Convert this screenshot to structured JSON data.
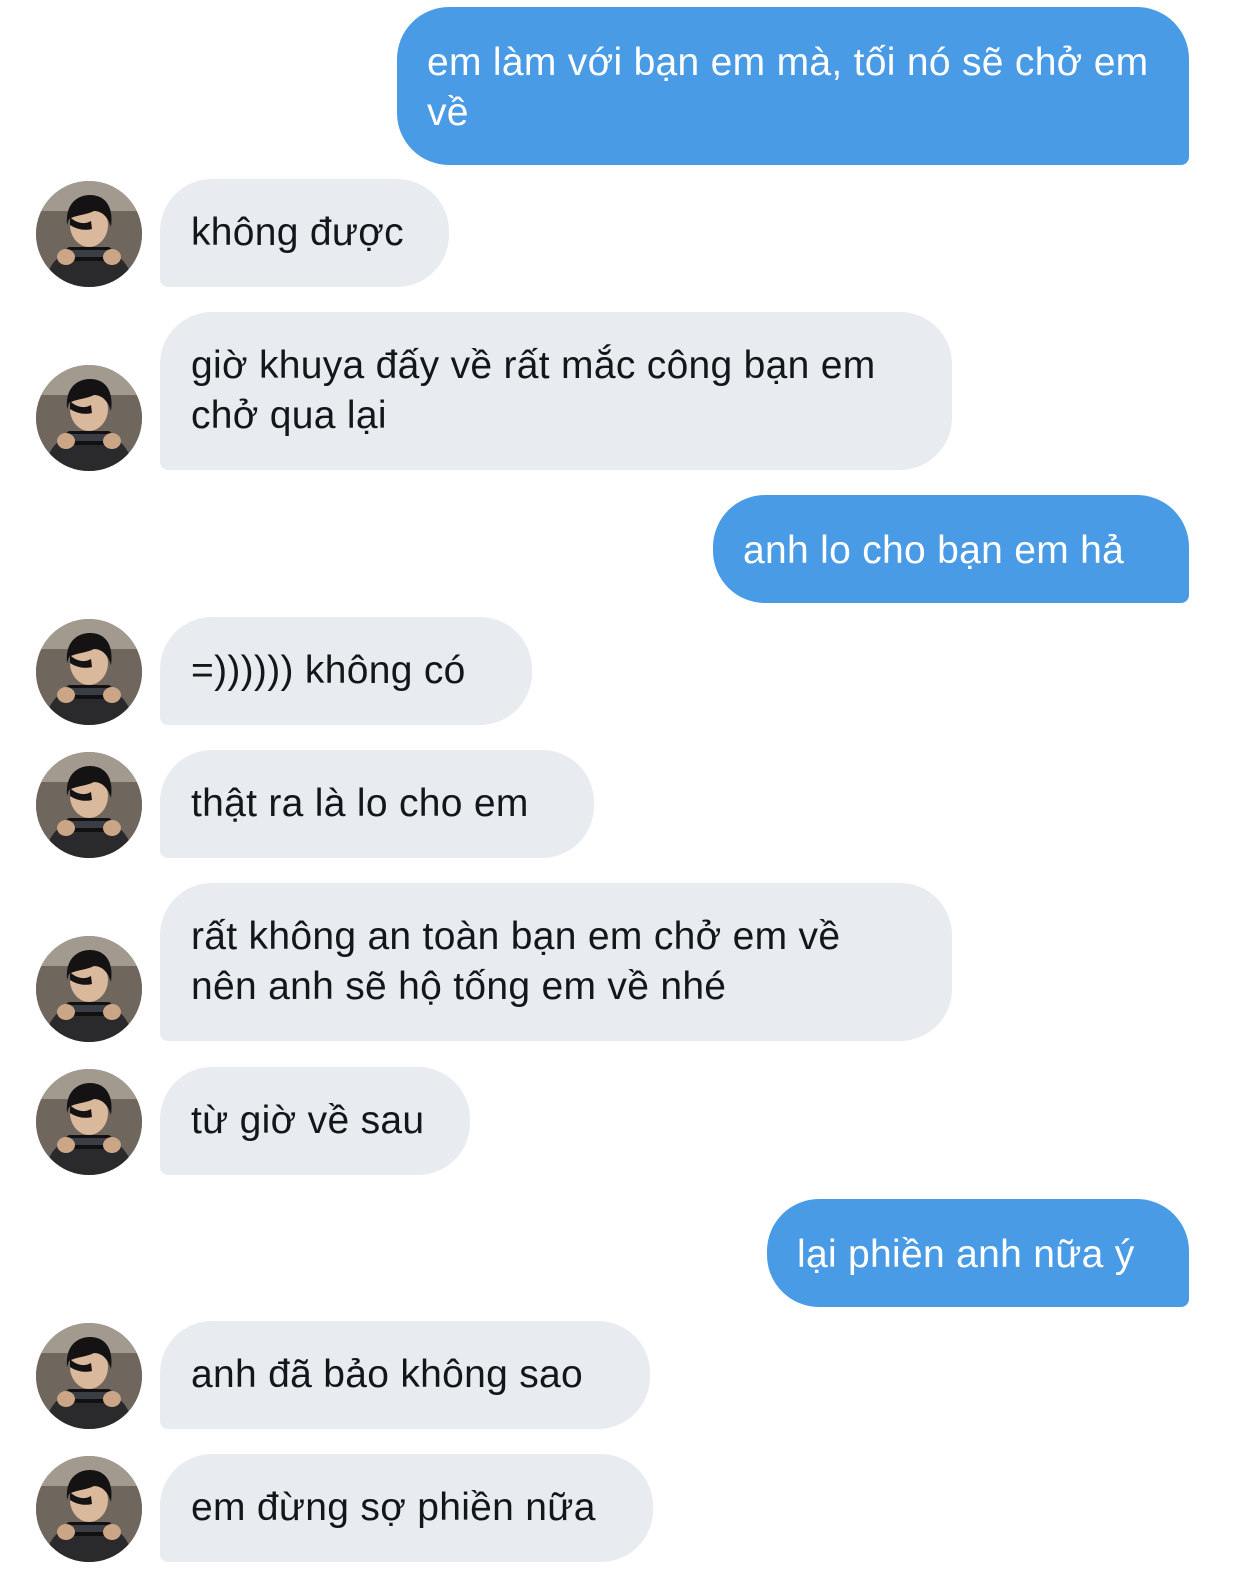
{
  "conversation": {
    "messages": [
      {
        "sender": "me",
        "text": "em làm với bạn em mà, tối nó sẽ chở em về"
      },
      {
        "sender": "contact",
        "text": "không được"
      },
      {
        "sender": "contact",
        "text": "giờ khuya đấy về rất mắc công bạn em chở qua lại"
      },
      {
        "sender": "me",
        "text": "anh lo cho bạn em hả"
      },
      {
        "sender": "contact",
        "text": "=)))))) không có"
      },
      {
        "sender": "contact",
        "text": "thật ra là lo cho em"
      },
      {
        "sender": "contact",
        "text": "rất không an toàn bạn em chở em về nên anh sẽ hộ tống em về nhé"
      },
      {
        "sender": "contact",
        "text": "từ giờ về sau"
      },
      {
        "sender": "me",
        "text": "lại phiền anh nữa ý"
      },
      {
        "sender": "contact",
        "text": "anh đã bảo không sao"
      },
      {
        "sender": "contact",
        "text": "em đừng sợ phiền nữa"
      }
    ]
  },
  "colors": {
    "sent_bubble": "#4a9be6",
    "sent_text": "#ffffff",
    "received_bubble": "#e8ebef",
    "received_text": "#14171a",
    "background": "#ffffff"
  },
  "icons": {
    "avatar": "contact-avatar-photo"
  }
}
